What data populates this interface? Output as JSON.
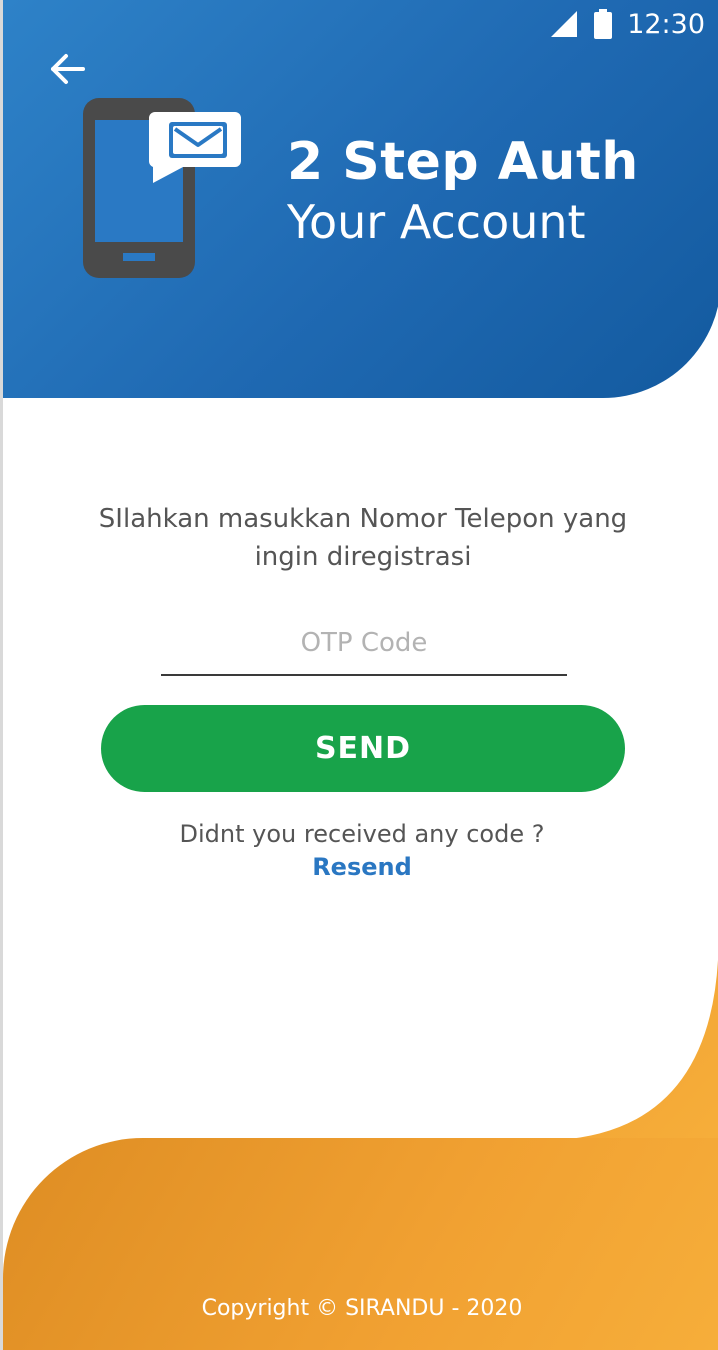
{
  "status_bar": {
    "time": "12:30",
    "icons": [
      "signal-icon",
      "battery-icon"
    ]
  },
  "header": {
    "back_icon": "arrow-left-icon",
    "illustration": "phone-message-icon",
    "title": "2 Step Auth",
    "subtitle": "Your Account"
  },
  "form": {
    "instruction": "SIlahkan masukkan Nomor Telepon yang ingin diregistrasi",
    "otp_placeholder": "OTP Code",
    "otp_value": "",
    "send_label": "SEND",
    "resend_question": "Didnt you received any code ?",
    "resend_label": "Resend"
  },
  "footer": {
    "copyright": "Copyright © SIRANDU - 2020"
  },
  "colors": {
    "header_blue": "#1f69b2",
    "send_green": "#18a34a",
    "link_blue": "#2a77c2",
    "footer_orange": "#f1a132"
  }
}
